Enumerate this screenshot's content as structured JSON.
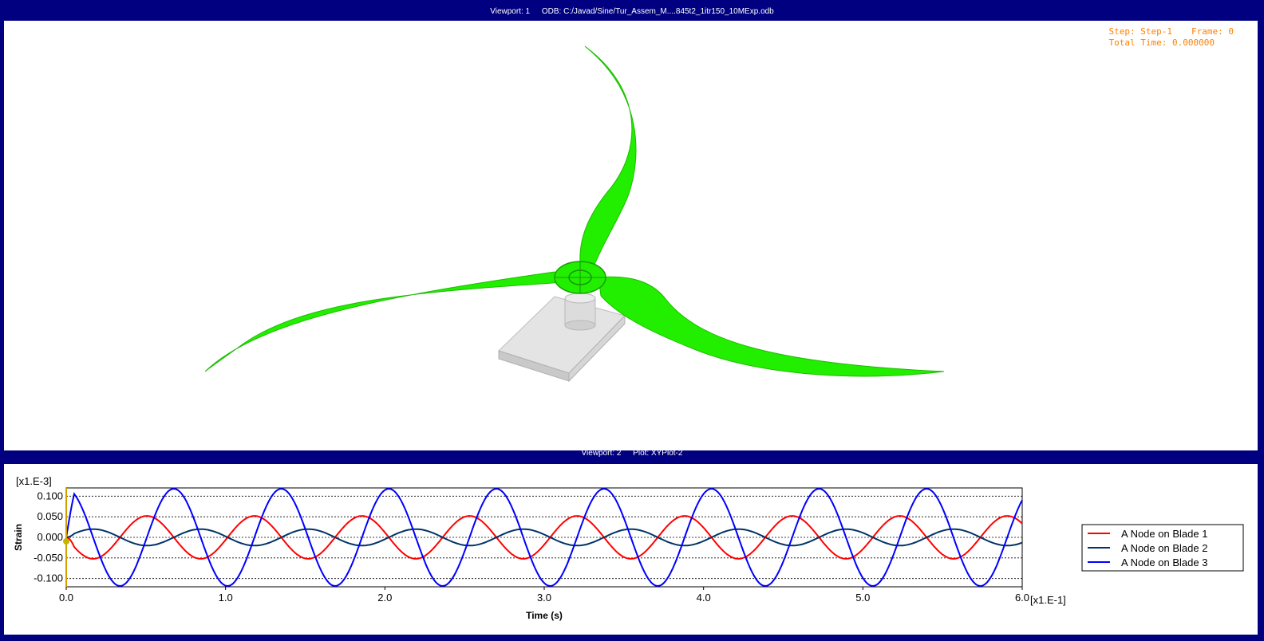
{
  "viewport1": {
    "label": "Viewport: 1",
    "odb": "ODB: C:/Javad/Sine/Tur_Assem_M....845t2_1itr150_10MExp.odb",
    "step_label": "Step: Step-1",
    "frame_label": "Frame: 0",
    "total_time_label": "Total Time: 0.000000"
  },
  "viewport2": {
    "label": "Viewport: 2",
    "plot": "Plot: XYPlot-2"
  },
  "colors": {
    "background": "#000080",
    "blade": "#22ee00",
    "status_text": "#ff8000",
    "blade1": "#ff0000",
    "blade2": "#003366",
    "blade3": "#0000ff"
  },
  "chart_data": {
    "type": "line",
    "xlabel": "Time (s)",
    "ylabel": "Strain",
    "x_multiplier": "[x1.E-1]",
    "y_multiplier": "[x1.E-3]",
    "xlim": [
      0.0,
      6.0
    ],
    "ylim": [
      -0.12,
      0.12
    ],
    "x_ticks": [
      "0.0",
      "1.0",
      "2.0",
      "3.0",
      "4.0",
      "5.0",
      "6.0"
    ],
    "y_ticks": [
      "0.100",
      "0.050",
      "0.000",
      "-0.050",
      "-0.100"
    ],
    "y_tick_values": [
      0.1,
      0.05,
      0.0,
      -0.05,
      -0.1
    ],
    "grid": true,
    "legend_position": "right",
    "period": 0.675,
    "series": [
      {
        "name": "A Node on Blade 1",
        "color": "#ff0000",
        "amplitude": 0.052,
        "phase_deg": 180
      },
      {
        "name": "A Node on Blade 2",
        "color": "#003366",
        "amplitude": 0.02,
        "phase_deg": 0
      },
      {
        "name": "A Node on Blade 3",
        "color": "#0000ff",
        "amplitude": 0.118,
        "phase_deg": 90
      }
    ]
  }
}
